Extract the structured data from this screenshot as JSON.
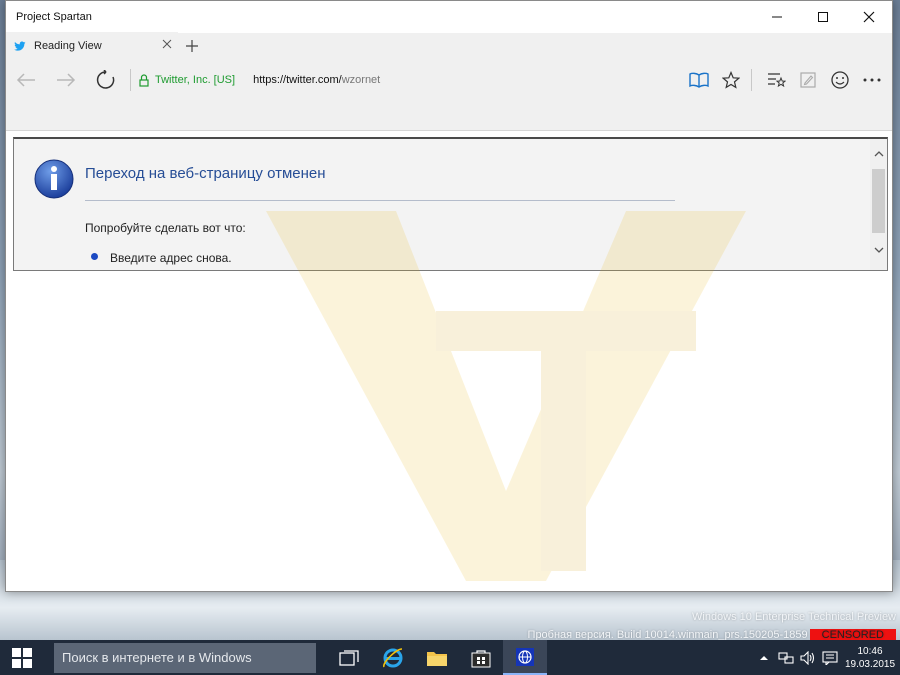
{
  "window": {
    "title": "Project Spartan"
  },
  "tab": {
    "label": "Reading View"
  },
  "address": {
    "certificate": "Twitter, Inc. [US]",
    "url_host": "https://twitter.com/",
    "url_path": "wzornet"
  },
  "error_page": {
    "title": "Переход на веб-страницу отменен",
    "try_label": "Попробуйте сделать вот что:",
    "items": [
      "Введите адрес снова."
    ]
  },
  "desktop": {
    "edition": "Windows 10 Enterprise Technical Preview",
    "build": "Пробная версия. Build 10014.winmain_prs.150205-1859",
    "censored": "CENSORED"
  },
  "taskbar": {
    "search_placeholder": "Поиск в интернете и в Windows",
    "time": "10:46",
    "date": "19.03.2015"
  },
  "colors": {
    "cert_green": "#1e9b30",
    "reading_view_blue": "#1a73c8",
    "error_title_blue": "#264d96",
    "taskbar": "#1f2a3a"
  }
}
